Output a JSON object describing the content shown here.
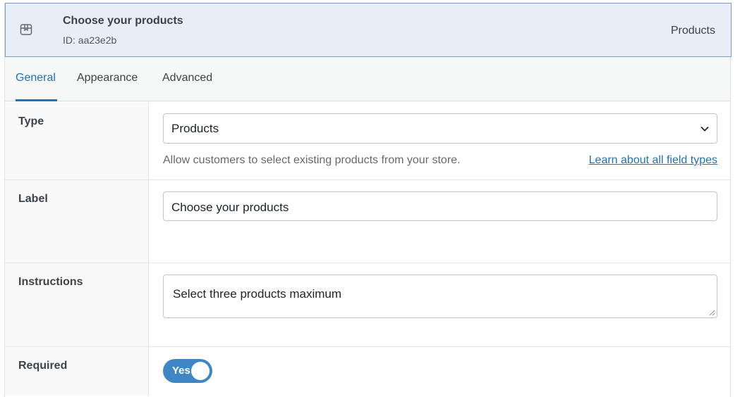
{
  "header": {
    "title": "Choose your products",
    "id_text": "ID: aa23e2b",
    "type_label": "Products",
    "icon": "product-box-icon"
  },
  "tabs": [
    {
      "label": "General",
      "active": true
    },
    {
      "label": "Appearance",
      "active": false
    },
    {
      "label": "Advanced",
      "active": false
    }
  ],
  "type_row": {
    "label": "Type",
    "selected": "Products",
    "description": "Allow customers to select existing products from your store.",
    "link_text": "Learn about all field types"
  },
  "label_row": {
    "label": "Label",
    "value": "Choose your products"
  },
  "instructions_row": {
    "label": "Instructions",
    "value": "Select three products maximum"
  },
  "required_row": {
    "label": "Required",
    "toggle_text": "Yes",
    "on": true
  },
  "colors": {
    "accent": "#2271b1",
    "header_bg": "#e6eff8",
    "toggle_on": "#3f87c4"
  }
}
